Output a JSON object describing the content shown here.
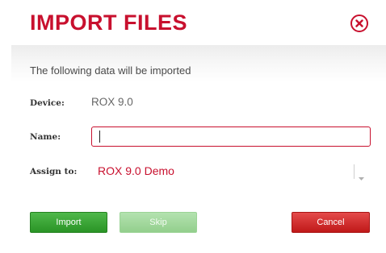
{
  "dialog": {
    "title": "IMPORT FILES",
    "close_icon": "close-circle-icon",
    "accent_color": "#c8102e"
  },
  "body": {
    "intro_text": "The following data will be imported",
    "device_label": "Device:",
    "device_value": "ROX 9.0",
    "name_label": "Name:",
    "name_value": "",
    "assign_label": "Assign to:",
    "assign_value": "ROX 9.0 Demo",
    "assign_arrow_icon": "chevron-down-icon"
  },
  "buttons": {
    "import_label": "Import",
    "skip_label": "Skip",
    "cancel_label": "Cancel",
    "import_color": "#2a9426",
    "skip_color": "#93cf8d",
    "cancel_color": "#c01919"
  }
}
